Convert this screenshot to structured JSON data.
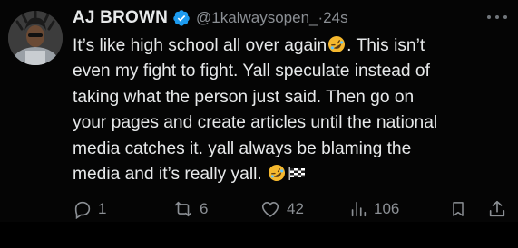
{
  "author": {
    "display_name": "AJ BROWN",
    "handle": "@1kalwaysopen_",
    "separator": "·",
    "time_ago": "24s",
    "verified": true
  },
  "tweet": {
    "lines": [
      "It’s like high school all over again",
      ". This isn’t",
      "even my fight to fight. Yall speculate instead of",
      "taking what the person just said.  Then go on",
      "your pages and create articles until the national",
      "media catches it. yall always be blaming the",
      "media and it’s really yall."
    ],
    "emojis": [
      "rolling-on-floor-laughing",
      "checkered-flag"
    ]
  },
  "actions": {
    "replies": "1",
    "reposts": "6",
    "likes": "42",
    "views": "106"
  },
  "colors": {
    "background": "#050505",
    "text": "#e7e9ea",
    "muted": "#8b8f94",
    "verified": "#1d9bf0"
  }
}
